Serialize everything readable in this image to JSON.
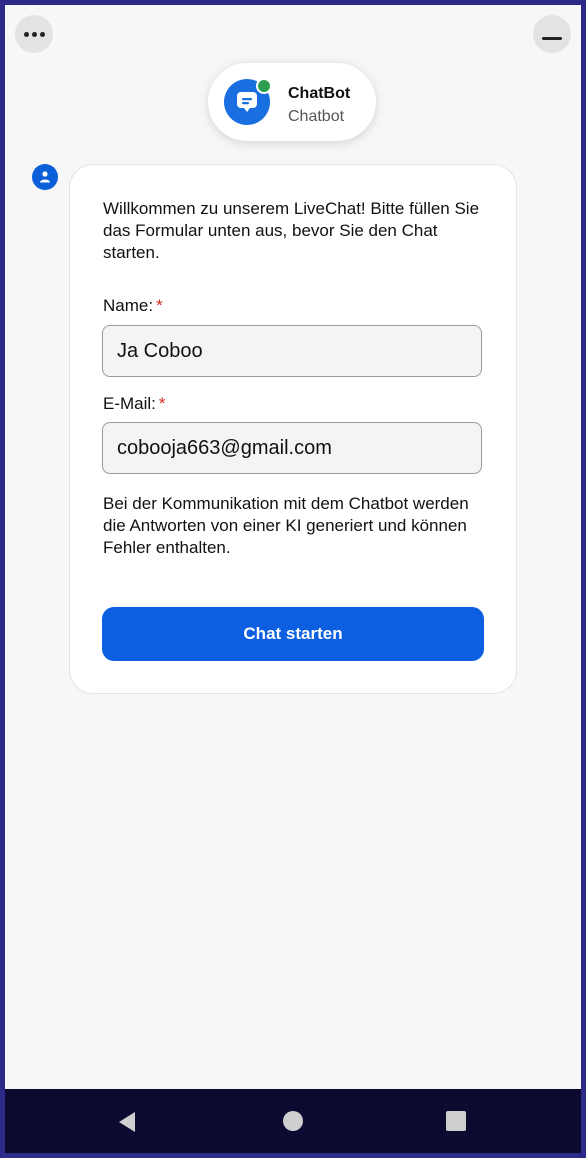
{
  "header": {
    "bot_name": "ChatBot",
    "bot_subtitle": "Chatbot",
    "online_color": "#2e9d4f"
  },
  "top_controls": {
    "menu_icon": "more-horizontal-icon",
    "minimize_icon": "minimize-icon"
  },
  "form": {
    "intro": "Willkommen zu unserem LiveChat! Bitte füllen Sie das Formular unten aus, bevor Sie den Chat starten.",
    "name_label": "Name:",
    "name_value": "Ja Coboo",
    "email_label": "E-Mail:",
    "email_value": "cobooja663@gmail.com",
    "required_marker": "*",
    "note": "Bei der Kommunikation mit dem Chatbot werden die Antworten von einer KI generiert und können Fehler enthalten.",
    "submit_label": "Chat starten",
    "accent_color": "#0b5fe0"
  },
  "navbar": {
    "back_icon": "back-triangle-icon",
    "home_icon": "home-circle-icon",
    "recents_icon": "recents-square-icon"
  }
}
